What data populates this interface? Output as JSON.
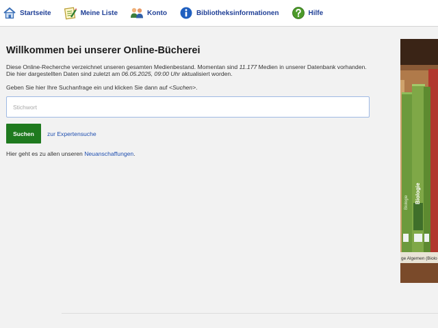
{
  "nav": [
    {
      "id": "startseite",
      "label": "Startseite",
      "icon": "home-icon"
    },
    {
      "id": "meine-liste",
      "label": "Meine Liste",
      "icon": "notepad-icon"
    },
    {
      "id": "konto",
      "label": "Konto",
      "icon": "users-icon"
    },
    {
      "id": "bibliotheksinformationen",
      "label": "Bibliotheksinformationen",
      "icon": "info-icon"
    },
    {
      "id": "hilfe",
      "label": "Hilfe",
      "icon": "help-icon"
    }
  ],
  "main": {
    "title": "Willkommen bei unserer Online-Bücherei",
    "intro_part1": "Diese Online-Recherche verzeichnet unseren gesamten Medienbestand. Momentan sind ",
    "media_count": "11.177",
    "intro_part2": " Medien in unserer Datenbank vorhanden.",
    "updated_part1": "Die hier dargestellten Daten sind zuletzt am ",
    "updated_at": "06.05.2025, 09:00 Uhr",
    "updated_part2": " aktualisiert worden.",
    "prompt_part1": "Geben Sie hier Ihre Suchanfrage ein und klicken Sie dann auf ",
    "prompt_em": "<Suchen>",
    "prompt_part2": ".",
    "search_placeholder": "Stichwort",
    "search_value": "",
    "search_button": "Suchen",
    "expert_link": "zur Expertensuche",
    "news_part1": "Hier geht es zu allen unseren ",
    "news_link": "Neuanschaffungen",
    "news_part2": "."
  },
  "photo": {
    "spine_text_1": "Biologie",
    "spine_text_2": "Biologie",
    "shelf_label": "ge Algemen (Biolo"
  },
  "colors": {
    "nav_text": "#1f3f96",
    "link": "#1f4fb0",
    "button_bg": "#1f7a1f",
    "input_border": "#9db8e3",
    "page_bg": "#f2f2f2"
  }
}
